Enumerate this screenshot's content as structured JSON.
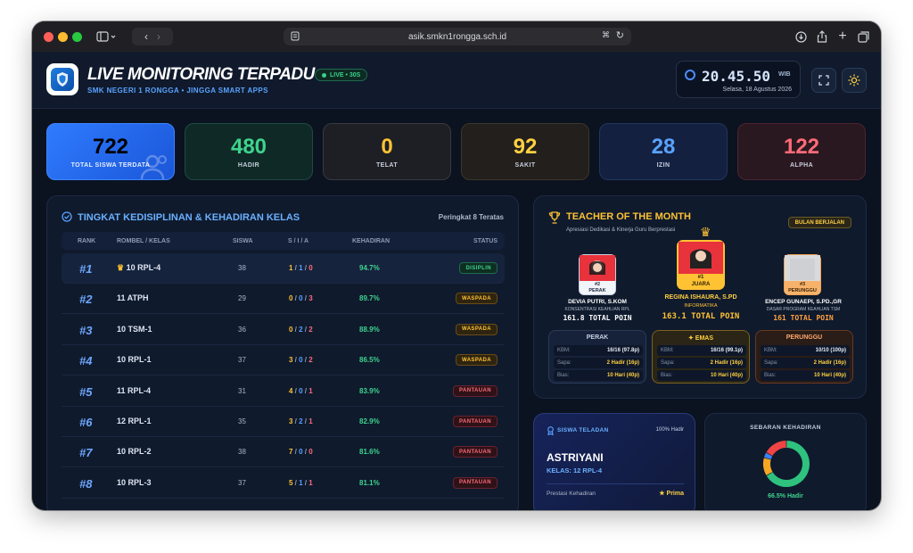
{
  "browser": {
    "url": "asik.smkn1rongga.sch.id"
  },
  "header": {
    "title": "LIVE MONITORING TERPADU",
    "live_badge": "LIVE • 30S",
    "subtitle": "SMK NEGERI 1 RONGGA • JINGGA SMART APPS",
    "clock": "20.45.50",
    "clock_unit": "WIB",
    "date": "Selasa, 18 Agustus 2026"
  },
  "stats": [
    {
      "value": "722",
      "label": "TOTAL SISWA TERDATA",
      "color": "#ffffff"
    },
    {
      "value": "480",
      "label": "HADIR",
      "color": "#3ed38d"
    },
    {
      "value": "0",
      "label": "TELAT",
      "color": "#ffc233"
    },
    {
      "value": "92",
      "label": "SAKIT",
      "color": "#ffd042"
    },
    {
      "value": "28",
      "label": "IZIN",
      "color": "#5aa2ff"
    },
    {
      "value": "122",
      "label": "ALPHA",
      "color": "#ff6b78"
    }
  ],
  "discipline": {
    "title": "TINGKAT KEDISIPLINAN & KEHADIRAN KELAS",
    "top_label": "Peringkat 8 Teratas",
    "columns": [
      "RANK",
      "ROMBEL / KELAS",
      "SISWA",
      "S / I / A",
      "KEHADIRAN",
      "STATUS"
    ],
    "rows": [
      {
        "rank": "#1",
        "kelas": "10 RPL-4",
        "siswa": "38",
        "s": "1",
        "i": "1",
        "a": "0",
        "kehadiran": "94.7%",
        "status": "DISIPLIN"
      },
      {
        "rank": "#2",
        "kelas": "11 ATPH",
        "siswa": "29",
        "s": "0",
        "i": "0",
        "a": "3",
        "kehadiran": "89.7%",
        "status": "WASPADA"
      },
      {
        "rank": "#3",
        "kelas": "10 TSM-1",
        "siswa": "36",
        "s": "0",
        "i": "2",
        "a": "2",
        "kehadiran": "88.9%",
        "status": "WASPADA"
      },
      {
        "rank": "#4",
        "kelas": "10 RPL-1",
        "siswa": "37",
        "s": "3",
        "i": "0",
        "a": "2",
        "kehadiran": "86.5%",
        "status": "WASPADA"
      },
      {
        "rank": "#5",
        "kelas": "11 RPL-4",
        "siswa": "31",
        "s": "4",
        "i": "0",
        "a": "1",
        "kehadiran": "83.9%",
        "status": "PANTAUAN"
      },
      {
        "rank": "#6",
        "kelas": "12 RPL-1",
        "siswa": "35",
        "s": "3",
        "i": "2",
        "a": "1",
        "kehadiran": "82.9%",
        "status": "PANTAUAN"
      },
      {
        "rank": "#7",
        "kelas": "10 RPL-2",
        "siswa": "38",
        "s": "7",
        "i": "0",
        "a": "0",
        "kehadiran": "81.6%",
        "status": "PANTAUAN"
      },
      {
        "rank": "#8",
        "kelas": "10 RPL-3",
        "siswa": "37",
        "s": "5",
        "i": "1",
        "a": "1",
        "kehadiran": "81.1%",
        "status": "PANTAUAN"
      }
    ]
  },
  "teacher": {
    "title": "TEACHER OF THE MONTH",
    "subtitle": "Apresiasi Dedikasi & Kinerja Guru Berprestasi",
    "period_badge": "BULAN BERJALAN",
    "podium": [
      {
        "place": "#2",
        "rank_label": "PERAK",
        "name": "DEVIA PUTRI, S.KOM",
        "dept": "KONSENTRASI KEAHLIAN RPL",
        "points": "161.8 TOTAL POIN"
      },
      {
        "place": "#1",
        "rank_label": "JUARA",
        "name": "REGINA ISHAURA, S.PD",
        "dept": "INFORMATIKA",
        "points": "163.1 TOTAL POIN"
      },
      {
        "place": "#3",
        "rank_label": "PERUNGGU",
        "name": "ENCEP GUNAEPI, S.PD.,GR",
        "dept": "DASAR PROGRAM KEAHLIAN TSM",
        "points": "161 TOTAL POIN"
      }
    ],
    "cards": [
      {
        "title": "PERAK",
        "rows": [
          [
            "KBM:",
            "16/16 (97.8p)"
          ],
          [
            "Sapa:",
            "2 Hadir (16p)"
          ],
          [
            "Bias:",
            "10 Hari (40p)"
          ]
        ]
      },
      {
        "title": "EMAS",
        "rows": [
          [
            "KBM:",
            "16/16 (99.1p)"
          ],
          [
            "Sapa:",
            "2 Hadir (16p)"
          ],
          [
            "Bias:",
            "10 Hari (40p)"
          ]
        ]
      },
      {
        "title": "PERUNGGU",
        "rows": [
          [
            "KBM:",
            "10/10 (100p)"
          ],
          [
            "Sapa:",
            "2 Hadir (16p)"
          ],
          [
            "Bias:",
            "10 Hari (40p)"
          ]
        ]
      }
    ]
  },
  "student": {
    "label": "SISWA TELADAN",
    "percent": "100% Hadir",
    "name": "ASTRIYANI",
    "kelas": "KELAS: 12 RPL-4",
    "footer_label": "Prestasi Kehadiran",
    "footer_value": "Prima"
  },
  "distribution": {
    "title": "SEBARAN KEHADIRAN",
    "caption": "66.5% Hadir"
  },
  "chart_data": {
    "type": "pie",
    "title": "SEBARAN KEHADIRAN",
    "categories": [
      "Hadir",
      "Telat",
      "Sakit",
      "Izin",
      "Alpha"
    ],
    "values": [
      480,
      0,
      92,
      28,
      122
    ],
    "colors": [
      "#2ec27e",
      "#ff9f1c",
      "#f5a623",
      "#3b82f6",
      "#ef4444"
    ]
  }
}
